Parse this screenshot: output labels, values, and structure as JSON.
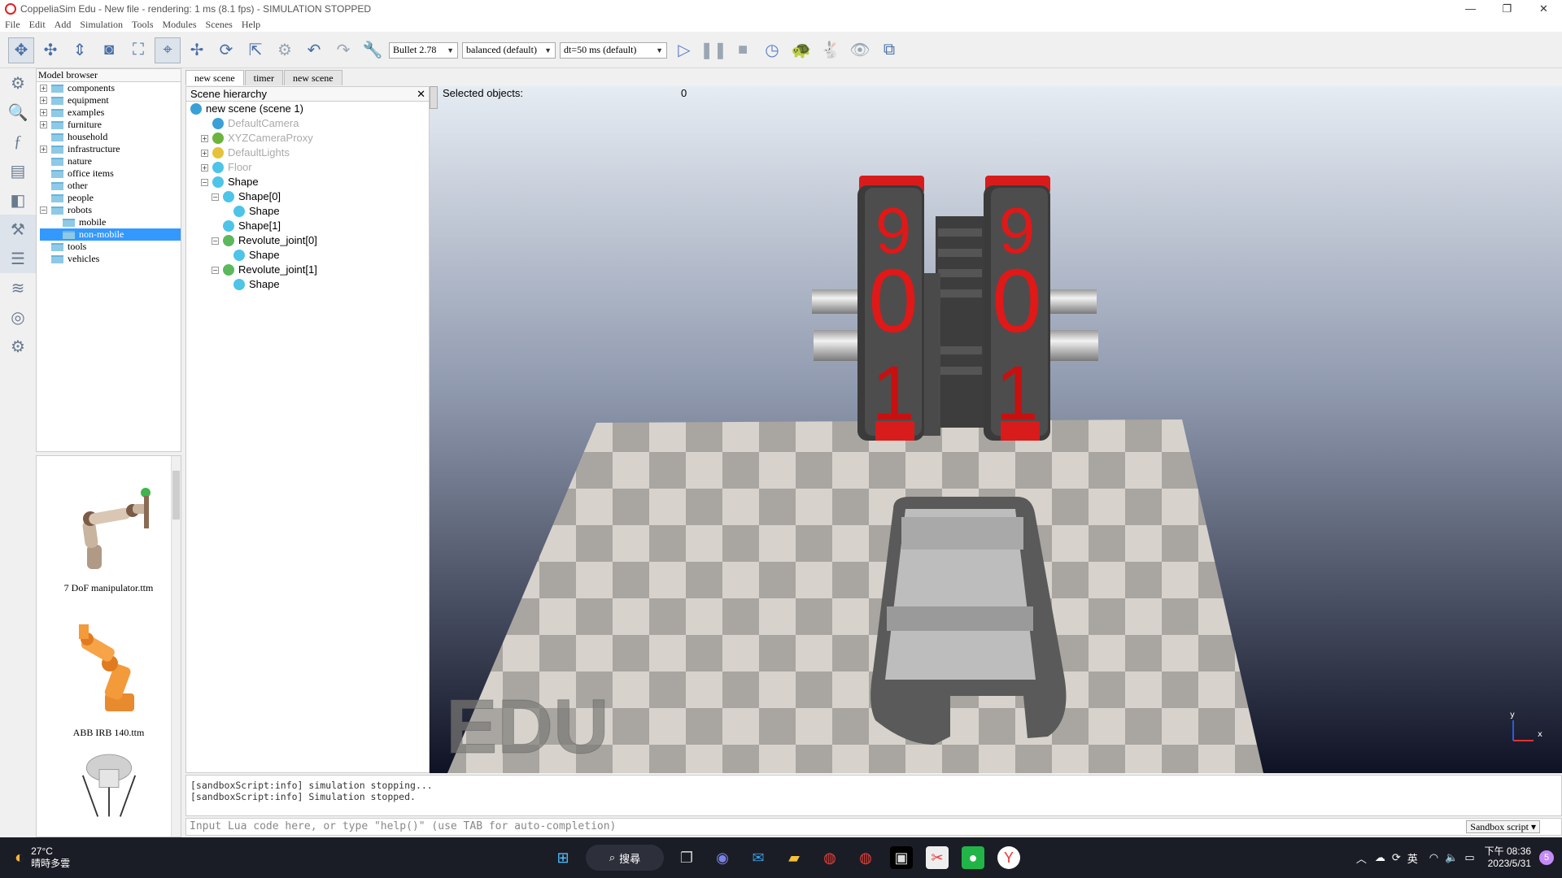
{
  "window": {
    "title": "CoppeliaSim Edu - New file - rendering: 1 ms (8.1 fps) - SIMULATION STOPPED"
  },
  "menu": [
    "File",
    "Edit",
    "Add",
    "Simulation",
    "Tools",
    "Modules",
    "Scenes",
    "Help"
  ],
  "toolbar": {
    "engine": "Bullet 2.78",
    "accuracy": "balanced (default)",
    "timestep": "dt=50 ms (default)"
  },
  "model_browser": {
    "title": "Model browser",
    "folders": [
      {
        "label": "components",
        "expandable": true
      },
      {
        "label": "equipment",
        "expandable": true
      },
      {
        "label": "examples",
        "expandable": true
      },
      {
        "label": "furniture",
        "expandable": true
      },
      {
        "label": "household",
        "expandable": false
      },
      {
        "label": "infrastructure",
        "expandable": true
      },
      {
        "label": "nature",
        "expandable": false
      },
      {
        "label": "office items",
        "expandable": false
      },
      {
        "label": "other",
        "expandable": false
      },
      {
        "label": "people",
        "expandable": false
      },
      {
        "label": "robots",
        "expandable": true,
        "expanded": true
      },
      {
        "label": "mobile",
        "child": true
      },
      {
        "label": "non-mobile",
        "child": true,
        "selected": true
      },
      {
        "label": "tools",
        "expandable": false
      },
      {
        "label": "vehicles",
        "expandable": false
      }
    ],
    "models": [
      "7 DoF manipulator.ttm",
      "ABB IRB 140.ttm"
    ]
  },
  "tabs": [
    "new scene",
    "timer",
    "new scene"
  ],
  "hierarchy": {
    "title": "Scene hierarchy",
    "rows": [
      {
        "label": "new scene (scene 1)",
        "indent": 0,
        "dim": false
      },
      {
        "label": "DefaultCamera",
        "indent": 1,
        "dim": true
      },
      {
        "label": "XYZCameraProxy",
        "indent": 1,
        "dim": true
      },
      {
        "label": "DefaultLights",
        "indent": 1,
        "dim": true
      },
      {
        "label": "Floor",
        "indent": 1,
        "dim": true
      },
      {
        "label": "Shape",
        "indent": 1,
        "dim": false
      },
      {
        "label": "Shape[0]",
        "indent": 2,
        "dim": false
      },
      {
        "label": "Shape",
        "indent": 3,
        "dim": false
      },
      {
        "label": "Shape[1]",
        "indent": 2,
        "dim": false
      },
      {
        "label": "Revolute_joint[0]",
        "indent": 2,
        "dim": false
      },
      {
        "label": "Shape",
        "indent": 3,
        "dim": false
      },
      {
        "label": "Revolute_joint[1]",
        "indent": 2,
        "dim": false
      },
      {
        "label": "Shape",
        "indent": 3,
        "dim": false
      }
    ]
  },
  "viewport": {
    "selected_label": "Selected objects:",
    "selected_count": "0",
    "watermark": "EDU",
    "digits_left": [
      "9",
      "0",
      "1"
    ],
    "digits_right": [
      "9",
      "0",
      "1"
    ]
  },
  "console": {
    "lines": [
      "[sandboxScript:info] simulation stopping...",
      "[sandboxScript:info] Simulation stopped."
    ],
    "placeholder": "Input Lua code here, or type \"help()\" (use TAB for auto-completion)",
    "script_selector": "Sandbox script"
  },
  "taskbar": {
    "temp": "27°C",
    "weather": "晴時多雲",
    "search": "搜尋",
    "lang": "英",
    "time": "下午 08:36",
    "date": "2023/5/31",
    "badge": "5"
  }
}
